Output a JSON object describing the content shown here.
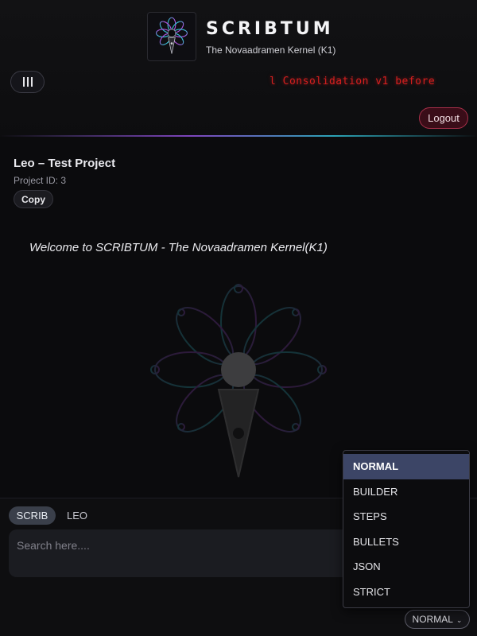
{
  "header": {
    "brand_title": "SCRIBTUM",
    "brand_subtitle": "The Novaadramen Kernel (K1)",
    "ticker_text": "l Consolidation v1 before",
    "logout_label": "Logout",
    "menu_icon": "bars-icon"
  },
  "project": {
    "title": "Leo – Test Project",
    "id_text": "Project ID: 3",
    "copy_label": "Copy"
  },
  "main": {
    "welcome_text": "Welcome to SCRIBTUM - The Novaadramen Kernel(K1)"
  },
  "composer": {
    "tabs": [
      {
        "label": "SCRIB",
        "active": true
      },
      {
        "label": "LEO",
        "active": false
      }
    ],
    "search_placeholder": "Search here....",
    "mode_label": "NORMAL",
    "mode_options": [
      "NORMAL",
      "BUILDER",
      "STEPS",
      "BULLETS",
      "JSON",
      "STRICT"
    ],
    "selected_mode": "NORMAL"
  },
  "colors": {
    "background": "#0b0b0d",
    "ticker_red": "#d41f1f",
    "logout_border": "#a8304a",
    "selected_option": "#3c4566",
    "accent_purple": "#8a4bd0",
    "accent_teal": "#2fb4c8"
  }
}
